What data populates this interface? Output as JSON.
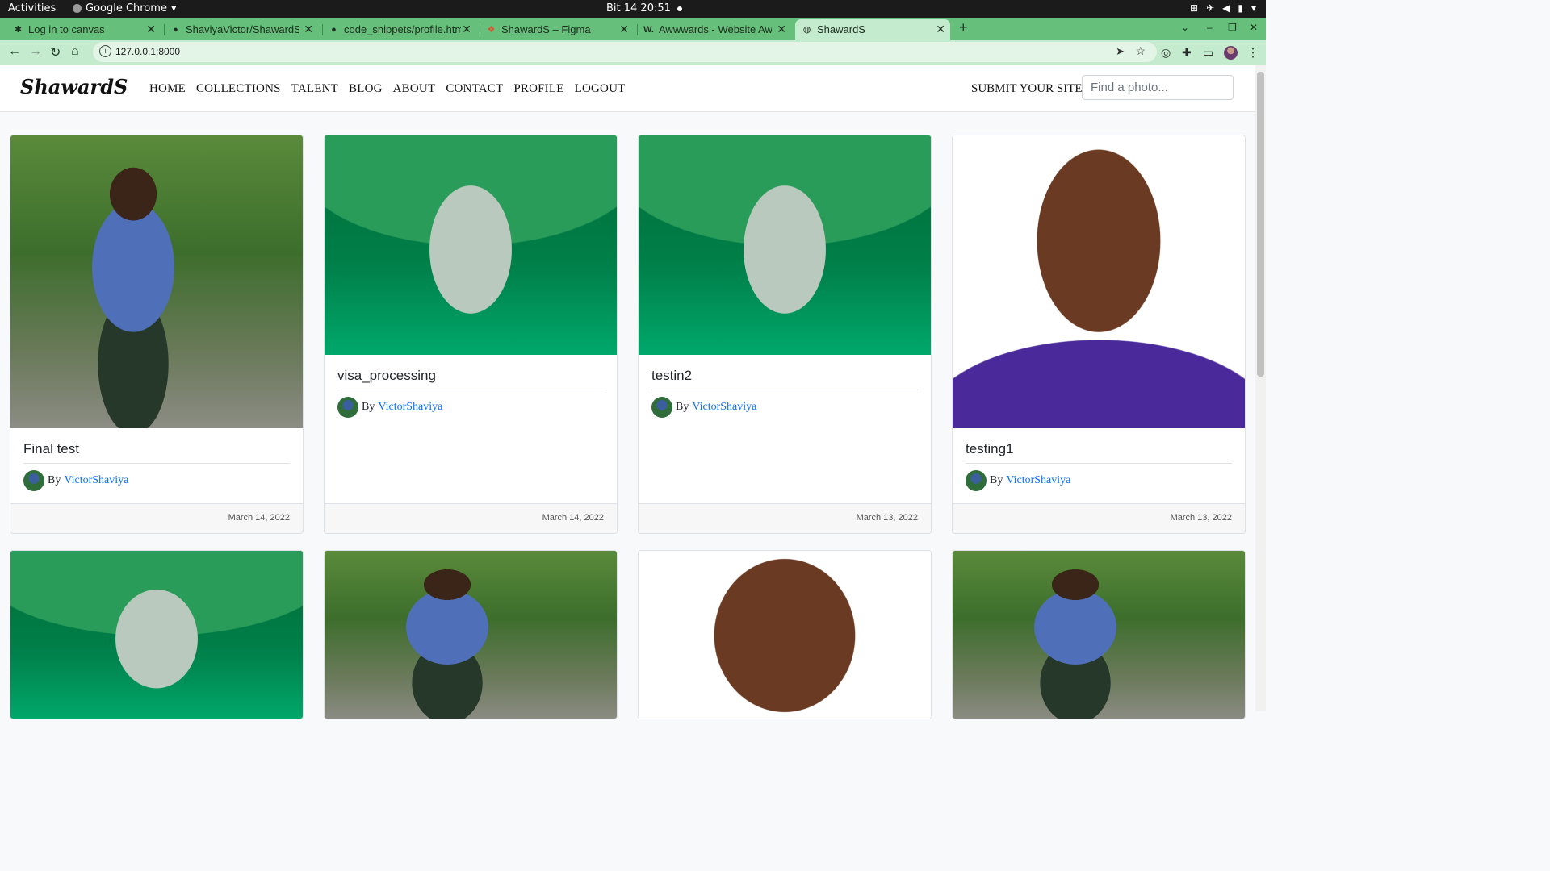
{
  "os": {
    "activities": "Activities",
    "app_name": "Google Chrome",
    "clock": "Bit 14  20:51"
  },
  "browser": {
    "tabs": [
      {
        "title": "Log in to canvas"
      },
      {
        "title": "ShaviyaVictor/ShawardS"
      },
      {
        "title": "code_snippets/profile.htm"
      },
      {
        "title": "ShawardS – Figma"
      },
      {
        "title": "Awwwards - Website Awa"
      },
      {
        "title": "ShawardS"
      }
    ],
    "url": "127.0.0.1:8000"
  },
  "site": {
    "brand": "ShawardS",
    "nav": [
      "HOME",
      "COLLECTIONS",
      "TALENT",
      "BLOG",
      "ABOUT",
      "CONTACT",
      "PROFILE",
      "LOGOUT"
    ],
    "submit_label": "SUBMIT YOUR SITE!",
    "search_placeholder": "Find a photo..."
  },
  "cards": [
    {
      "title": "Final test",
      "by": "By",
      "author": "VictorShaviya",
      "date": "March 14, 2022",
      "image": "person-walking"
    },
    {
      "title": "visa_processing",
      "by": "By",
      "author": "VictorShaviya",
      "date": "March 14, 2022",
      "image": "sad-egg"
    },
    {
      "title": "testin2",
      "by": "By",
      "author": "VictorShaviya",
      "date": "March 13, 2022",
      "image": "sad-egg"
    },
    {
      "title": "testing1",
      "by": "By",
      "author": "VictorShaviya",
      "date": "March 13, 2022",
      "image": "portrait"
    }
  ],
  "row2_images": [
    "sad-egg",
    "person-walking",
    "portrait",
    "person-walking"
  ],
  "colors": {
    "tabstrip": "#66bf7a",
    "toolbar": "#c5ebce",
    "link": "#0d6efd"
  }
}
